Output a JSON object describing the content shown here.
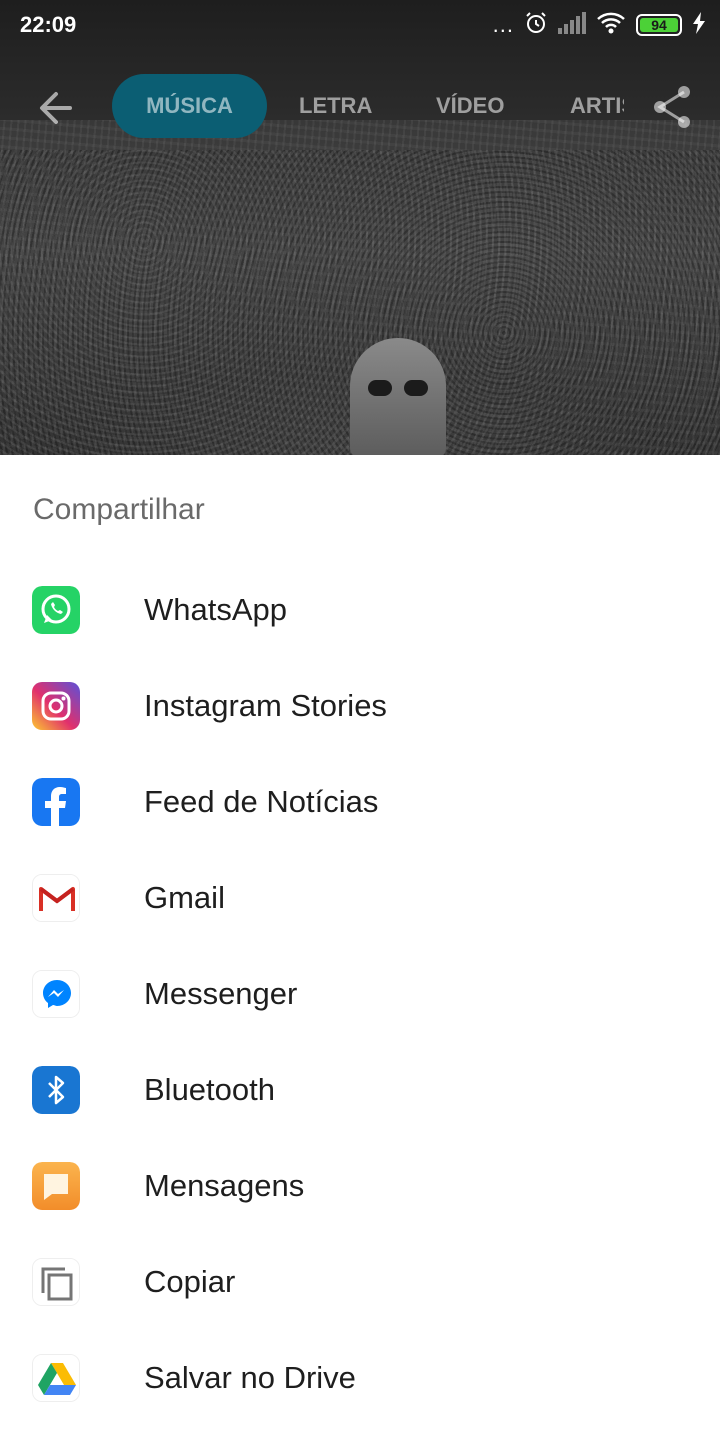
{
  "status_bar": {
    "time": "22:09",
    "more_indicator": "...",
    "battery_level": "94",
    "icons": [
      "more-dots-icon",
      "alarm-icon",
      "cell-signal-icon",
      "wifi-icon",
      "battery-icon",
      "charging-bolt-icon"
    ]
  },
  "nav": {
    "back_icon": "back-arrow-icon",
    "tabs": [
      {
        "label": "MÚSICA",
        "active": true
      },
      {
        "label": "LETRA",
        "active": false
      },
      {
        "label": "VÍDEO",
        "active": false
      },
      {
        "label": "ARTISTA",
        "active": false
      }
    ],
    "share_icon": "share-icon",
    "accent_color": "#0b5e73"
  },
  "share_sheet": {
    "title": "Compartilhar",
    "options": [
      {
        "label": "WhatsApp",
        "icon": "whatsapp-icon",
        "color": "#25d366"
      },
      {
        "label": "Instagram Stories",
        "icon": "instagram-icon",
        "color": "#c13584"
      },
      {
        "label": "Feed de Notícias",
        "icon": "facebook-icon",
        "color": "#1877f2"
      },
      {
        "label": "Gmail",
        "icon": "gmail-icon",
        "color": "#d93025"
      },
      {
        "label": "Messenger",
        "icon": "messenger-icon",
        "color": "#0084ff"
      },
      {
        "label": "Bluetooth",
        "icon": "bluetooth-icon",
        "color": "#1976d2"
      },
      {
        "label": "Mensagens",
        "icon": "messages-icon",
        "color": "#f7a03b"
      },
      {
        "label": "Copiar",
        "icon": "copy-icon",
        "color": "#757575"
      },
      {
        "label": "Salvar no Drive",
        "icon": "google-drive-icon",
        "color": "#1fa463"
      }
    ]
  }
}
